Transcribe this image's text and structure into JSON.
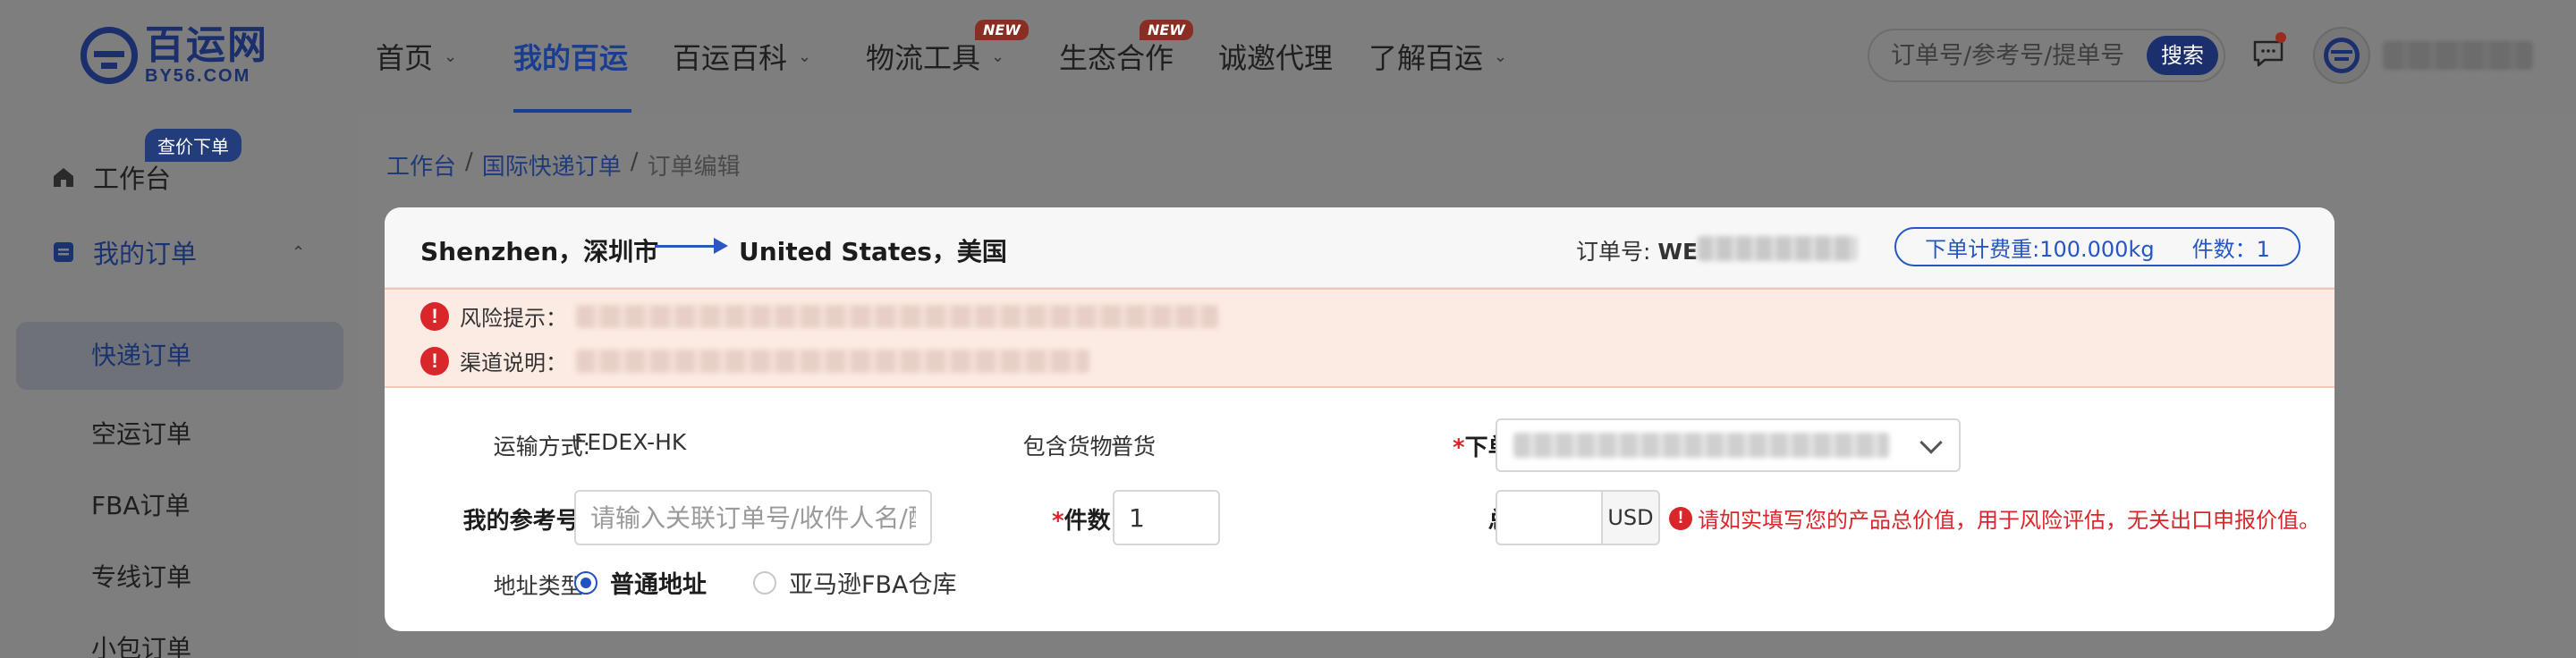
{
  "logo": {
    "cn": "百运网",
    "en": "BY56.COM"
  },
  "nav": {
    "items": [
      {
        "label": "首页",
        "chevron": true
      },
      {
        "label": "我的百运",
        "active": true
      },
      {
        "label": "百运百科",
        "chevron": true
      },
      {
        "label": "物流工具",
        "chevron": true,
        "badge": "NEW"
      },
      {
        "label": "生态合作",
        "badge": "NEW"
      },
      {
        "label": "诚邀代理"
      },
      {
        "label": "了解百运",
        "chevron": true
      }
    ],
    "search_placeholder": "订单号/参考号/提单号",
    "search_button": "搜索"
  },
  "sidebar": {
    "quote_badge": "查价下单",
    "items": [
      {
        "label": "工作台",
        "icon": "home-icon"
      },
      {
        "label": "我的订单",
        "icon": "order-icon",
        "expanded": true
      }
    ],
    "sub_items": [
      "快递订单",
      "空运订单",
      "FBA订单",
      "专线订单",
      "小包订单"
    ],
    "active_sub": "快递订单"
  },
  "breadcrumb": {
    "items": [
      "工作台",
      "国际快递订单"
    ],
    "current": "订单编辑",
    "sep": "/"
  },
  "order": {
    "from": "Shenzhen，深圳市",
    "to": "United States，美国",
    "order_no_label": "订单号:",
    "order_no_prefix": "WE",
    "fee_label": "下单计费重:100.000kg",
    "count_label": "件数：1"
  },
  "risk": {
    "risk_label": "风险提示：",
    "channel_label": "渠道说明："
  },
  "form": {
    "transport_label": "运输方式:",
    "transport_value": "FEDEX-HK",
    "goods_label": "包含货物:",
    "goods_value": "普货",
    "account_label": "下单账号:",
    "ref_label": "我的参考号:",
    "ref_placeholder": "请输入关联订单号/收件人名/配",
    "pieces_label": "件数:",
    "pieces_value": "1",
    "value_label": "总货值:",
    "currency": "USD",
    "value_warning": "请如实填写您的产品总价值，用于风险评估，无关出口申报价值。",
    "address_label": "地址类型:",
    "address_options": [
      "普通地址",
      "亚马逊FBA仓库"
    ],
    "address_selected": "普通地址",
    "required_mark": "*"
  },
  "colors": {
    "brand": "#1a2f6b",
    "accent": "#2556c4",
    "danger": "#d8262b",
    "overlay": "#7f7f7f"
  }
}
